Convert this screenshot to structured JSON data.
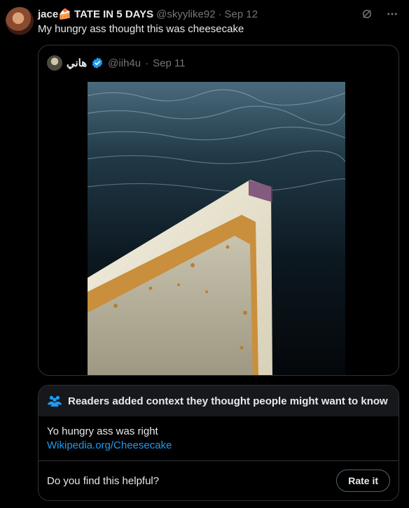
{
  "tweet": {
    "display_name": "jace🍰 TATE IN 5 DAYS",
    "handle": "@skyylike92",
    "separator": "·",
    "date": "Sep 12",
    "text": "My hungry ass thought this was cheesecake",
    "icons": [
      "grok-icon",
      "more-icon"
    ]
  },
  "quoted": {
    "display_name": "هاني",
    "verified": true,
    "handle": "@iih4u",
    "separator": "·",
    "date": "Sep 11"
  },
  "community_note": {
    "header": "Readers added context they thought people might want to know",
    "text": "Yo hungry ass was right",
    "link": "Wikipedia.org/Cheesecake",
    "question": "Do you find this helpful?",
    "rate_label": "Rate it"
  },
  "colors": {
    "background": "#000000",
    "text": "#e7e9ea",
    "muted": "#71767b",
    "border": "#2f3336",
    "link": "#1d9bf0",
    "verified": "#1d9bf0"
  }
}
